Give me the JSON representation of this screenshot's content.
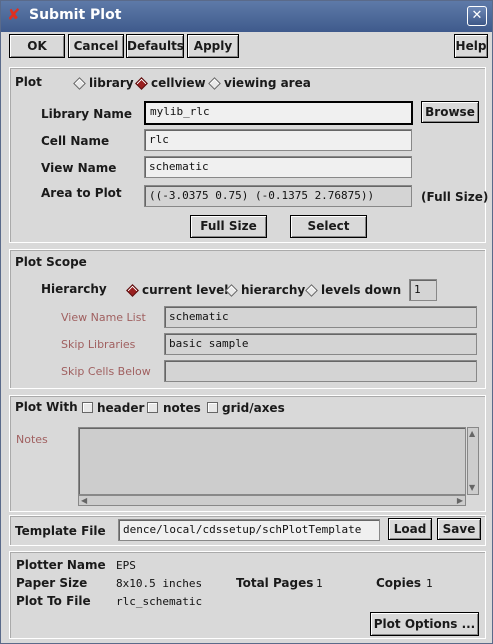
{
  "window": {
    "title": "Submit Plot",
    "close_label": "✕"
  },
  "toolbar": {
    "ok": "OK",
    "cancel": "Cancel",
    "defaults": "Defaults",
    "apply": "Apply",
    "help": "Help"
  },
  "plot": {
    "label": "Plot",
    "options": [
      "library",
      "cellview",
      "viewing area"
    ],
    "selected": "cellview",
    "library_name_label": "Library Name",
    "library_name": "mylib_rlc",
    "browse": "Browse",
    "cell_name_label": "Cell Name",
    "cell_name": "rlc",
    "view_name_label": "View Name",
    "view_name": "schematic",
    "area_label": "Area to Plot",
    "area_value": "((-3.0375 0.75) (-0.1375 2.76875))",
    "area_tag": "(Full Size)",
    "full_size": "Full Size",
    "select": "Select"
  },
  "scope": {
    "label": "Plot Scope",
    "hierarchy_label": "Hierarchy",
    "options": [
      "current level",
      "hierarchy",
      "levels down"
    ],
    "selected": "current level",
    "levels_down": "1",
    "view_name_list_label": "View Name List",
    "view_name_list": "schematic",
    "skip_libraries_label": "Skip Libraries",
    "skip_libraries": "basic sample",
    "skip_cells_label": "Skip Cells Below",
    "skip_cells": ""
  },
  "plot_with": {
    "label": "Plot With",
    "options": [
      "header",
      "notes",
      "grid/axes"
    ],
    "notes_label": "Notes"
  },
  "template": {
    "label": "Template File",
    "value": "dence/local/cdssetup/schPlotTemplate",
    "load": "Load",
    "save": "Save"
  },
  "plotter": {
    "plotter_name_label": "Plotter Name",
    "plotter_name": "EPS",
    "paper_size_label": "Paper Size",
    "paper_size": "8x10.5 inches",
    "total_pages_label": "Total Pages",
    "total_pages": "1",
    "copies_label": "Copies",
    "copies": "1",
    "plot_to_file_label": "Plot To File",
    "plot_to_file": "rlc_schematic",
    "plot_options": "Plot Options ..."
  }
}
